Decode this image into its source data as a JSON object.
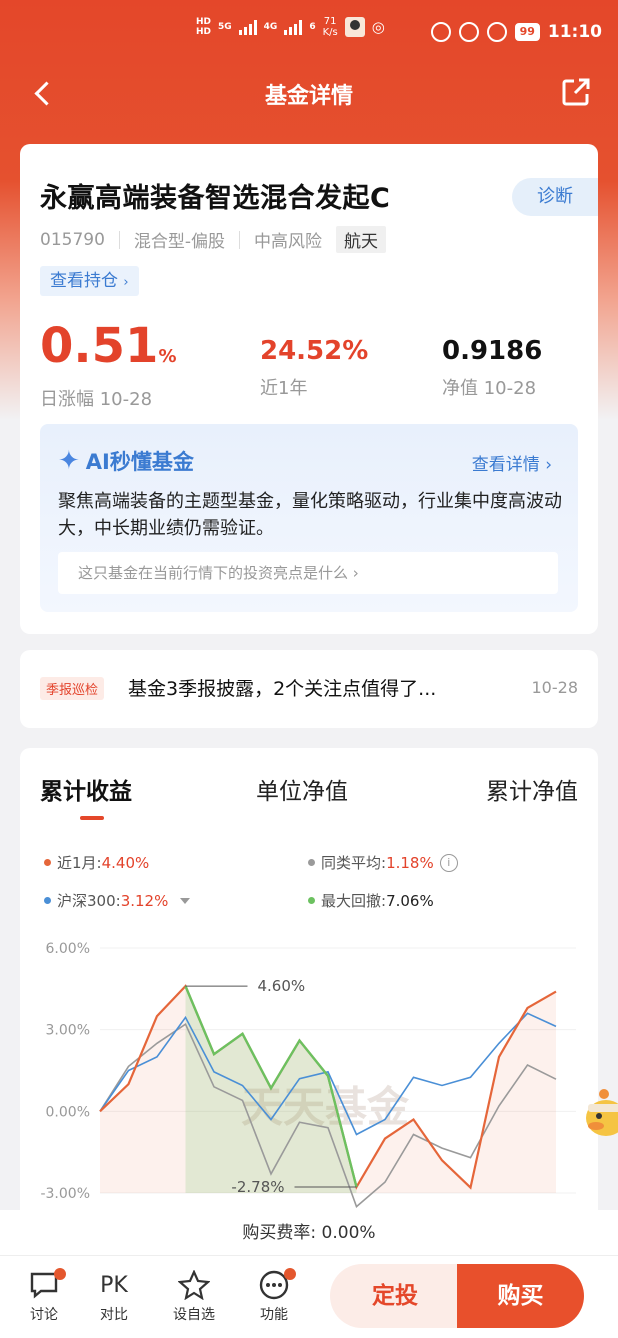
{
  "status_bar": {
    "hd1": "HD",
    "hd2": "HD",
    "net1": "5G",
    "net2": "4G",
    "wifi_num": "6",
    "speed_value": "71",
    "speed_unit": "K/s",
    "battery": "99",
    "time": "11:10"
  },
  "nav": {
    "title": "基金详情"
  },
  "fund": {
    "name": "永赢高端装备智选混合发起C",
    "diagnose_label": "诊断",
    "code": "015790",
    "type": "混合型-偏股",
    "risk": "中高风险",
    "theme_tag": "航天",
    "holdings_label": "查看持仓",
    "daily_change": "0.51",
    "daily_change_unit": "%",
    "daily_change_label": "日涨幅 10-28",
    "year_return": "24.52%",
    "year_return_label": "近1年",
    "nav_value": "0.9186",
    "nav_label": "净值 10-28"
  },
  "ai": {
    "title": "AI秒懂基金",
    "link": "查看详情",
    "summary": "聚焦高端装备的主题型基金，量化策略驱动，行业集中度高波动大，中长期业绩仍需验证。",
    "question": "这只基金在当前行情下的投资亮点是什么"
  },
  "quarterly": {
    "tag": "季报巡检",
    "text": "基金3季报披露，2个关注点值得了...",
    "date": "10-28"
  },
  "chart_tabs": [
    "累计收益",
    "单位净值",
    "累计净值"
  ],
  "legend": {
    "fund_label": "近1月:",
    "fund_value": "4.40%",
    "peer_label": "同类平均:",
    "peer_value": "1.18%",
    "index_label": "沪深300:",
    "index_value": "3.12%",
    "drawdown_label": "最大回撤:",
    "drawdown_value": "7.06%"
  },
  "colors": {
    "fund": "#e5663a",
    "index": "#4a8fd6",
    "peer": "#9a9a9a",
    "drawdown": "#6cc160"
  },
  "chart_data": {
    "type": "line",
    "x": [
      0,
      1,
      2,
      3,
      4,
      5,
      6,
      7,
      8,
      9,
      10,
      11,
      12,
      13,
      14,
      15,
      16,
      17,
      18,
      19,
      20,
      21
    ],
    "ylim": [
      -3.0,
      6.0
    ],
    "ytick_labels": [
      "6.00%",
      "3.00%",
      "0.00%",
      "-3.00%"
    ],
    "yticks": [
      6.0,
      3.0,
      0.0,
      -3.0
    ],
    "series": [
      {
        "key": "fund",
        "values": [
          0.0,
          1.0,
          3.5,
          4.6,
          2.1,
          2.85,
          0.85,
          2.6,
          1.3,
          -2.78,
          -1.0,
          -0.3,
          -1.8,
          -2.8,
          2.0,
          3.8,
          4.4
        ]
      },
      {
        "key": "index",
        "values": [
          0.0,
          1.5,
          2.0,
          3.45,
          1.45,
          0.95,
          -0.3,
          1.2,
          1.45,
          -0.85,
          -0.3,
          1.25,
          0.95,
          1.25,
          2.5,
          3.6,
          3.12
        ]
      },
      {
        "key": "peer",
        "values": [
          0.0,
          1.65,
          2.5,
          3.2,
          0.9,
          0.4,
          -2.3,
          -0.4,
          -0.6,
          -3.5,
          -2.6,
          -0.85,
          -1.35,
          -1.7,
          0.2,
          1.7,
          1.18
        ]
      }
    ],
    "drawdown": {
      "start_index": 3,
      "end_index": 9,
      "peak_label": "4.60%",
      "trough_label": "-2.78%"
    },
    "watermark": "天天基金"
  },
  "fee": {
    "label": "购买费率: 0.00%"
  },
  "bottom": {
    "discuss": "讨论",
    "compare_icon": "PK",
    "compare": "对比",
    "watchlist": "设自选",
    "functions": "功能",
    "auto_invest": "定投",
    "buy": "购买"
  }
}
